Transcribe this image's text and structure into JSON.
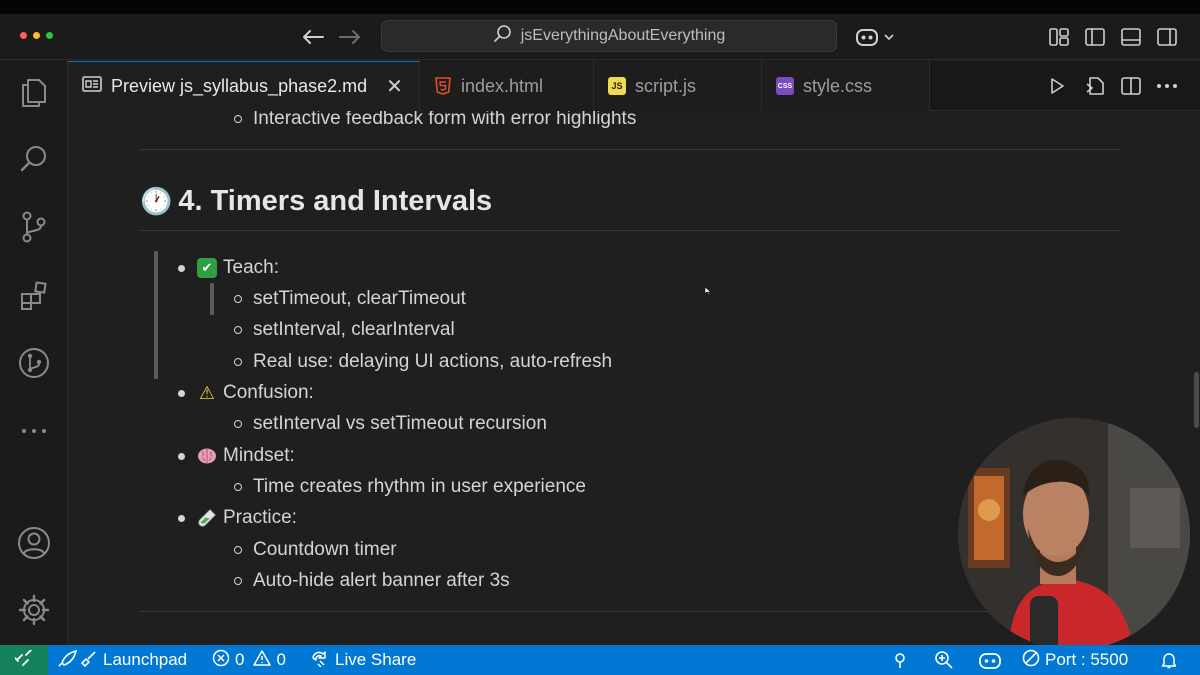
{
  "titlebar": {
    "search_text": "jsEverythingAboutEverything"
  },
  "tabs": [
    {
      "label": "Preview js_syllabus_phase2.md",
      "icon": "preview-icon",
      "active": true
    },
    {
      "label": "index.html",
      "icon": "html5-icon",
      "active": false
    },
    {
      "label": "script.js",
      "icon": "js-icon",
      "active": false
    },
    {
      "label": "style.css",
      "icon": "css-icon",
      "active": false
    }
  ],
  "preview": {
    "top_item": "Interactive feedback form with error highlights",
    "heading_emoji": "🕐",
    "heading": "4. Timers and Intervals",
    "sections": [
      {
        "emoji": "✅",
        "label": "Teach:",
        "items": [
          "setTimeout, clearTimeout",
          "setInterval, clearInterval",
          "Real use: delaying UI actions, auto-refresh"
        ]
      },
      {
        "emoji": "⚠️",
        "label": "Confusion:",
        "items": [
          "setInterval vs setTimeout recursion"
        ]
      },
      {
        "emoji": "🧠",
        "label": "Mindset:",
        "items": [
          "Time creates rhythm in user experience"
        ]
      },
      {
        "emoji": "🧪",
        "label": "Practice:",
        "items": [
          "Countdown timer",
          "Auto-hide alert banner after 3s"
        ]
      }
    ]
  },
  "statusbar": {
    "launchpad": "Launchpad",
    "errors": "0",
    "warnings": "0",
    "live_share": "Live Share",
    "port": "Port : 5500"
  },
  "colors": {
    "accent": "#0078d4",
    "remote": "#16825d",
    "html": "#e44d26",
    "js": "#f0db4f",
    "css": "#7c4dbf"
  }
}
